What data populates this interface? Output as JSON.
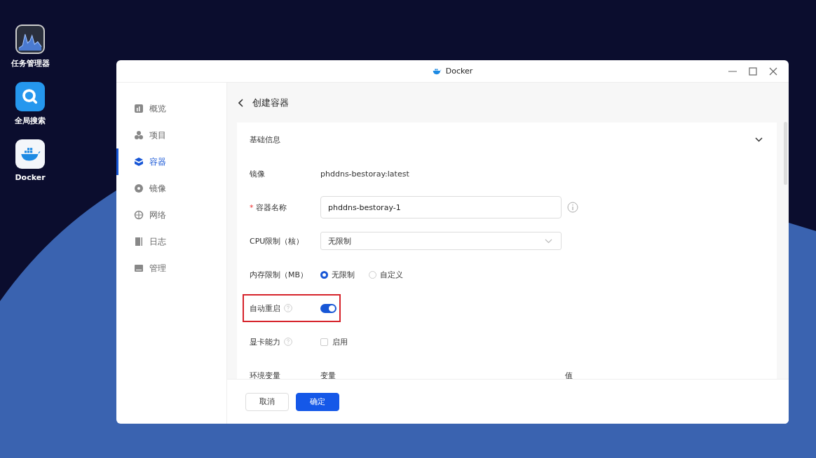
{
  "desktop_icons": [
    {
      "label": "任务管理器"
    },
    {
      "label": "全局搜索"
    },
    {
      "label": "Docker"
    }
  ],
  "window": {
    "title": "Docker"
  },
  "sidebar": {
    "items": [
      {
        "label": "概览",
        "selected": false
      },
      {
        "label": "项目",
        "selected": false
      },
      {
        "label": "容器",
        "selected": true
      },
      {
        "label": "镜像",
        "selected": false
      },
      {
        "label": "网络",
        "selected": false
      },
      {
        "label": "日志",
        "selected": false
      },
      {
        "label": "管理",
        "selected": false
      }
    ]
  },
  "page": {
    "title": "创建容器"
  },
  "section": {
    "title": "基础信息",
    "expanded": true
  },
  "fields": [
    {
      "kind": "text",
      "label": "镜像",
      "help": false,
      "highlighted": false,
      "value": "phddns-bestoray:latest"
    },
    {
      "kind": "input",
      "label": "容器名称",
      "required_mark": "*",
      "help": false,
      "highlighted": false,
      "value": "phddns-bestoray-1"
    },
    {
      "kind": "select",
      "label": "CPU限制（核）",
      "help": false,
      "highlighted": false,
      "value": "无限制"
    },
    {
      "kind": "radio",
      "label": "内存限制（MB）",
      "help": false,
      "highlighted": false,
      "options": [
        {
          "label": "无限制",
          "selected": true
        },
        {
          "label": "自定义",
          "selected": false
        }
      ]
    },
    {
      "kind": "switch",
      "label": "自动重启",
      "help": true,
      "highlighted": true,
      "on": true
    },
    {
      "kind": "checkbox",
      "label": "显卡能力",
      "help": true,
      "highlighted": false,
      "checked": false,
      "option": "启用"
    },
    {
      "kind": "table",
      "label": "环境变量",
      "help": false,
      "highlighted": false,
      "columns": [
        "变量",
        "值"
      ]
    }
  ],
  "buttons": [
    {
      "label": "取消",
      "kind": "secondary"
    },
    {
      "label": "确定",
      "kind": "primary"
    }
  ]
}
